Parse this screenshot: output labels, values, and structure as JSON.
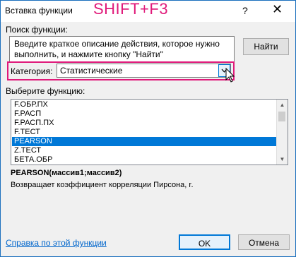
{
  "window": {
    "title": "Вставка функции",
    "shortcut_annotation": "SHIFT+F3",
    "help_glyph": "?",
    "close_glyph": "✕"
  },
  "search": {
    "label": "Поиск функции:",
    "description": "Введите краткое описание действия, которое нужно выполнить, и нажмите кнопку \"Найти\"",
    "find_button": "Найти"
  },
  "category": {
    "label": "Категория:",
    "selected": "Статистические",
    "highlight_color": "#e0197a"
  },
  "function_list": {
    "label": "Выберите функцию:",
    "items": [
      "F.ОБР.ПХ",
      "F.РАСП",
      "F.РАСП.ПХ",
      "F.ТЕСТ",
      "PEARSON",
      "Z.ТЕСТ",
      "БЕТА.ОБР"
    ],
    "selected": "PEARSON"
  },
  "details": {
    "signature": "PEARSON(массив1;массив2)",
    "description": "Возвращает коэффициент корреляции Пирсона, r."
  },
  "footer": {
    "help_link": "Справка по этой функции",
    "ok_button": "OK",
    "cancel_button": "Отмена"
  },
  "colors": {
    "accent": "#0078d7",
    "annotation": "#e0197a"
  }
}
